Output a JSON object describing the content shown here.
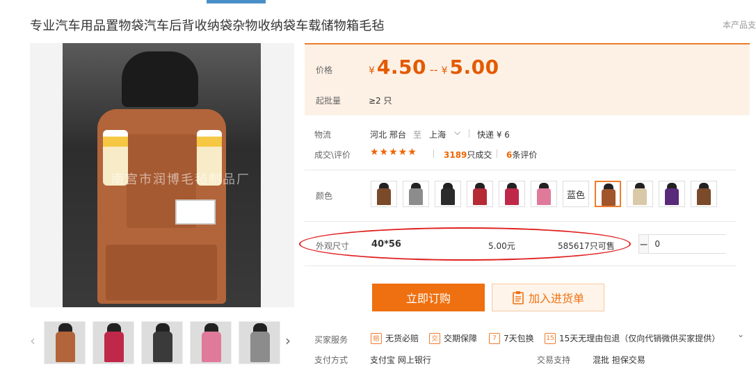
{
  "product": {
    "title": "专业汽车用品置物袋汽车后背收纳袋杂物收纳袋车载储物箱毛毡",
    "corner_note": "本产品支",
    "watermark": "南宫市润博毛毡制品厂"
  },
  "price": {
    "label": "价格",
    "currency": "¥",
    "min": "4.50",
    "separator": "--",
    "max": "5.00",
    "moq_label": "起批量",
    "moq_value": "≥2 只"
  },
  "logistics": {
    "label": "物流",
    "from": "河北 邢台",
    "to_word": "至",
    "to": "上海",
    "express": "快递 ¥ 6"
  },
  "deals": {
    "label": "成交\\评价",
    "rating": 5,
    "stars": "★★★★★",
    "sold_count": "3189",
    "sold_suffix": "只成交",
    "review_count": "6",
    "review_suffix": "条评价"
  },
  "colors": {
    "label": "颜色",
    "text_option": "蓝色",
    "swatches": [
      "#7a4a2a",
      "#8c8c8c",
      "#2b2b2b",
      "#b52a35",
      "#c0284a",
      "#e07a9a",
      "#1f4e9a",
      "#a0552b",
      "#d9c9a8",
      "#5a2a7a",
      "#7a4a2a"
    ],
    "selected_index": 7
  },
  "size": {
    "label": "外观尺寸",
    "value": "40*56",
    "price": "5.00元",
    "stock": "585617只可售",
    "quantity": "0"
  },
  "actions": {
    "order": "立即订购",
    "cart": "加入进货单"
  },
  "services": {
    "label": "买家服务",
    "items": [
      {
        "icon": "赔",
        "text": "无货必赔"
      },
      {
        "icon": "交",
        "text": "交期保障"
      },
      {
        "icon": "7",
        "text": "7天包换"
      },
      {
        "icon": "15",
        "text": "15天无理由包退（仅向代销微供买家提供）"
      }
    ]
  },
  "payment": {
    "label": "支付方式",
    "value": "支付宝 网上银行",
    "trade_label": "交易支持",
    "trade_value": "混批 担保交易"
  }
}
